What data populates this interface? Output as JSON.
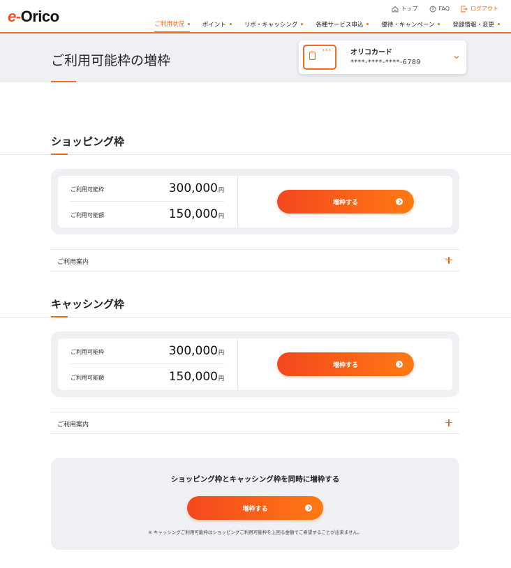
{
  "header": {
    "logo": {
      "e": "e",
      "dash": "-",
      "text": "Orico"
    },
    "utility": [
      {
        "label": "トップ",
        "icon": "home-icon"
      },
      {
        "label": "FAQ",
        "icon": "help-icon"
      },
      {
        "label": "ログアウト",
        "icon": "logout-icon"
      }
    ],
    "nav": [
      {
        "label": "ご利用状況",
        "active": true
      },
      {
        "label": "ポイント"
      },
      {
        "label": "リボ・キャッシング"
      },
      {
        "label": "各種サービス申込"
      },
      {
        "label": "優待・キャンペーン"
      },
      {
        "label": "登録情報・変更"
      }
    ]
  },
  "page": {
    "title": "ご利用可能枠の増枠"
  },
  "card": {
    "name": "オリコカード",
    "number": "****-****-****-6789",
    "chip_dots": "***"
  },
  "shopping": {
    "title": "ショッピング枠",
    "available_label": "ご利用可能枠",
    "available_value": "300,000",
    "used_label": "ご利用可能額",
    "used_value": "150,000",
    "currency": "円",
    "button": "増枠する",
    "guide": "ご利用案内"
  },
  "cashing": {
    "title": "キャッシング枠",
    "available_label": "ご利用可能枠",
    "available_value": "300,000",
    "used_label": "ご利用可能額",
    "used_value": "150,000",
    "currency": "円",
    "button": "増枠する",
    "guide": "ご利用案内"
  },
  "combined": {
    "title": "ショッピング枠とキャッシング枠を同時に増枠する",
    "button": "増枠する",
    "note": "※ キャッシングご利用可能枠はショッピングご利用可能枠を上回る金額でご希望することが出来ません。"
  },
  "colors": {
    "accent": "#f26a1b",
    "band": "#eff0f3"
  }
}
